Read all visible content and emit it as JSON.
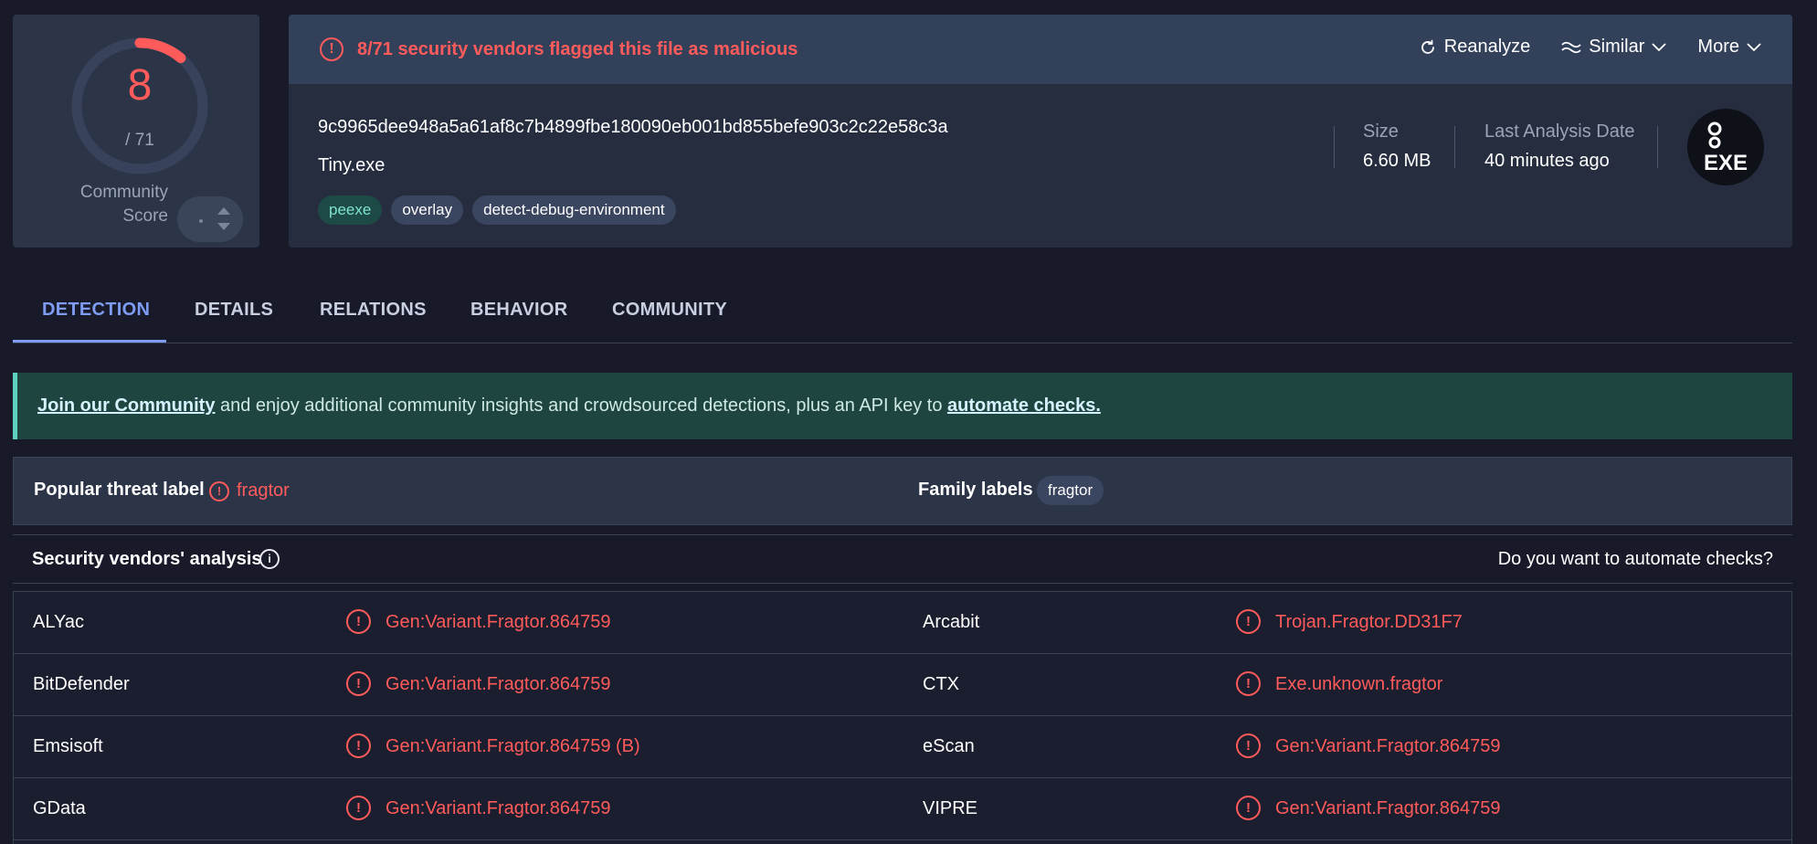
{
  "score": {
    "detections": "8",
    "total": "/ 71",
    "detected_count": 8,
    "total_count": 71,
    "community_label_line1": "Community",
    "community_label_line2": "Score"
  },
  "alert": {
    "text": "8/71 security vendors flagged this file as malicious"
  },
  "actions": {
    "reanalyze": "Reanalyze",
    "similar": "Similar",
    "more": "More"
  },
  "file": {
    "hash": "9c9965dee948a5a61af8c7b4899fbe180090eb001bd855befe903c2c22e58c3a",
    "name": "Tiny.exe",
    "tags": [
      "peexe",
      "overlay",
      "detect-debug-environment"
    ],
    "size_label": "Size",
    "size_value": "6.60 MB",
    "date_label": "Last Analysis Date",
    "date_value": "40 minutes ago",
    "type_badge": "EXE"
  },
  "tabs": [
    "DETECTION",
    "DETAILS",
    "RELATIONS",
    "BEHAVIOR",
    "COMMUNITY"
  ],
  "banner": {
    "link1": "Join our Community",
    "middle": " and enjoy additional community insights and crowdsourced detections, plus an API key to ",
    "link2": "automate checks."
  },
  "threat": {
    "popular_label": "Popular threat label",
    "popular_value": "fragtor",
    "family_label": "Family labels",
    "family_value": "fragtor"
  },
  "vendors": {
    "title": "Security vendors' analysis",
    "cta": "Do you want to automate checks?",
    "rows": [
      {
        "left_name": "ALYac",
        "left_result": "Gen:Variant.Fragtor.864759",
        "right_name": "Arcabit",
        "right_result": "Trojan.Fragtor.DD31F7"
      },
      {
        "left_name": "BitDefender",
        "left_result": "Gen:Variant.Fragtor.864759",
        "right_name": "CTX",
        "right_result": "Exe.unknown.fragtor"
      },
      {
        "left_name": "Emsisoft",
        "left_result": "Gen:Variant.Fragtor.864759 (B)",
        "right_name": "eScan",
        "right_result": "Gen:Variant.Fragtor.864759"
      },
      {
        "left_name": "GData",
        "left_result": "Gen:Variant.Fragtor.864759",
        "right_name": "VIPRE",
        "right_result": "Gen:Variant.Fragtor.864759"
      }
    ]
  },
  "colors": {
    "danger": "#ff5b5b",
    "accent": "#7f9cf5",
    "banner": "#1e4540"
  }
}
